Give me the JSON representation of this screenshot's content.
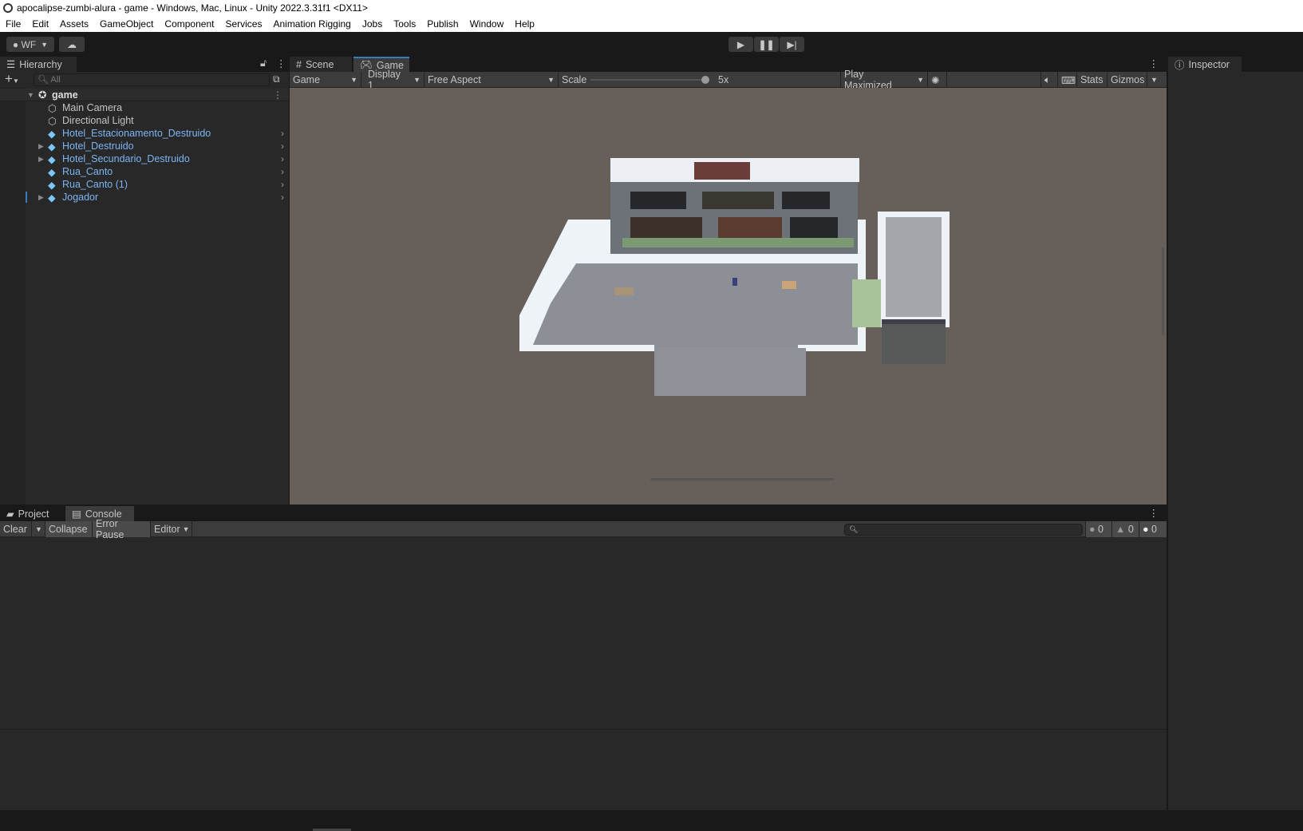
{
  "window": {
    "title": "apocalipse-zumbi-alura - game - Windows, Mac, Linux - Unity 2022.3.31f1 <DX11>"
  },
  "menu": [
    "File",
    "Edit",
    "Assets",
    "GameObject",
    "Component",
    "Services",
    "Animation Rigging",
    "Jobs",
    "Tools",
    "Publish",
    "Window",
    "Help"
  ],
  "toolbar": {
    "account": "WF",
    "play_icon": "play-icon",
    "pause_icon": "pause-icon",
    "step_icon": "step-icon"
  },
  "hierarchy": {
    "tab": "Hierarchy",
    "search_placeholder": "All",
    "scene": "game",
    "items": [
      {
        "label": "Main Camera",
        "type": "gameobject",
        "expandable": false,
        "prefab": false
      },
      {
        "label": "Directional Light",
        "type": "gameobject",
        "expandable": false,
        "prefab": false
      },
      {
        "label": "Hotel_Estacionamento_Destruido",
        "type": "model-prefab",
        "expandable": false,
        "prefab": true
      },
      {
        "label": "Hotel_Destruido",
        "type": "model-prefab",
        "expandable": true,
        "prefab": true
      },
      {
        "label": "Hotel_Secundario_Destruido",
        "type": "model-prefab",
        "expandable": true,
        "prefab": true
      },
      {
        "label": "Rua_Canto",
        "type": "prefab",
        "expandable": false,
        "prefab": true
      },
      {
        "label": "Rua_Canto (1)",
        "type": "prefab",
        "expandable": false,
        "prefab": true
      },
      {
        "label": "Jogador",
        "type": "prefab",
        "expandable": true,
        "prefab": true
      }
    ]
  },
  "game": {
    "tabs": [
      "Scene",
      "Game"
    ],
    "active_tab": "Game",
    "mode": "Game",
    "display": "Display 1",
    "aspect": "Free Aspect",
    "scale_label": "Scale",
    "scale_value": "5x",
    "play_mode": "Play Maximized",
    "stats": "Stats",
    "gizmos": "Gizmos",
    "background": "#675f59"
  },
  "inspector": {
    "tab": "Inspector"
  },
  "bottom": {
    "tabs": [
      "Project",
      "Console"
    ],
    "active_tab": "Console",
    "clear": "Clear",
    "collapse": "Collapse",
    "error_pause": "Error Pause",
    "editor": "Editor",
    "counts": {
      "info": "0",
      "warnings": "0",
      "errors": "0"
    }
  },
  "colors": {
    "accent": "#3a79bb",
    "prefab": "#7cb4f4"
  }
}
